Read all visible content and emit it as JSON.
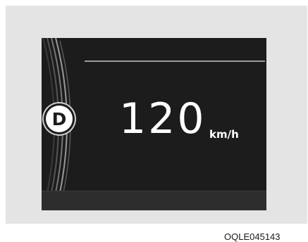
{
  "display": {
    "gear": "D",
    "speed": "120",
    "unit": "km/h"
  },
  "figure_code": "OQLE045143",
  "icons": {
    "gear_indicator": "gear-position-d-icon"
  },
  "colors": {
    "screen_background": "#1c1c1c",
    "text": "#ffffff",
    "frame": "#e4e4e4"
  }
}
